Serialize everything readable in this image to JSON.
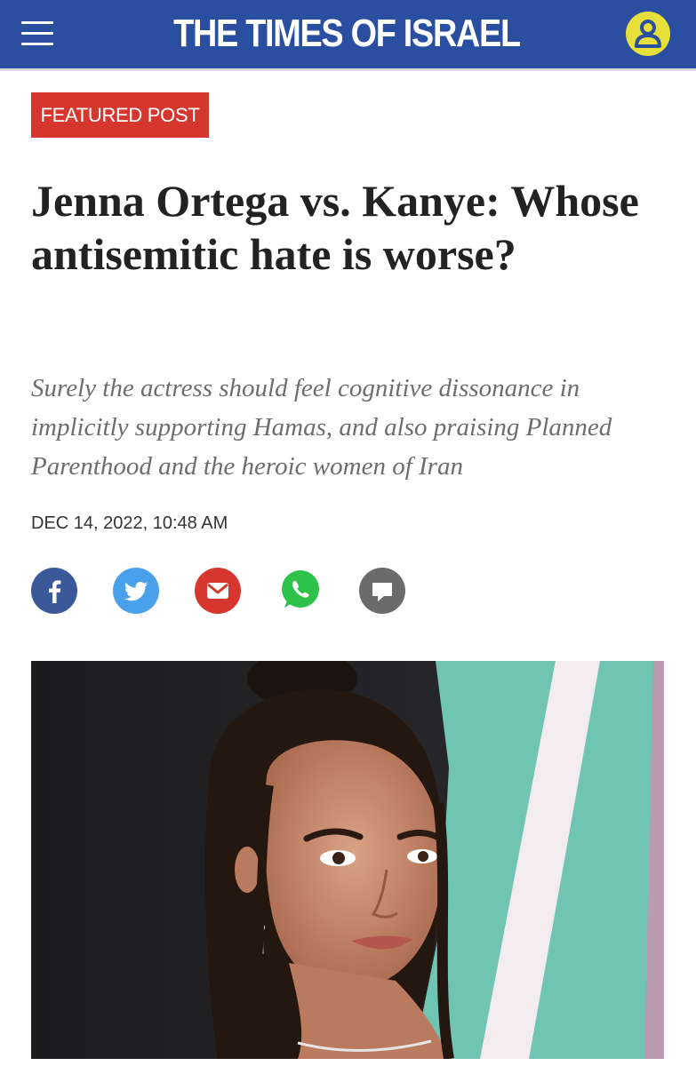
{
  "header": {
    "site_title": "THE TIMES OF ISRAEL",
    "menu_icon": "hamburger-menu-icon",
    "account_icon": "user-account-icon",
    "bar_color": "#2a4fa0",
    "account_color": "#e8e03a"
  },
  "article": {
    "badge": "FEATURED POST",
    "badge_color": "#d5372f",
    "headline": "Jenna Ortega vs. Kanye: Whose antisemitic hate is worse?",
    "subheadline": "Surely the actress should feel cognitive dissonance in implicitly supporting Hamas, and also praising Planned Parenthood and the heroic women of Iran",
    "date": "DEC 14, 2022, 10:48 AM"
  },
  "share_buttons": [
    {
      "icon": "facebook-icon",
      "color": "#3b5998"
    },
    {
      "icon": "twitter-icon",
      "color": "#4aa1eb"
    },
    {
      "icon": "email-icon",
      "color": "#d5372f"
    },
    {
      "icon": "whatsapp-icon",
      "color": "#2fc24a"
    },
    {
      "icon": "comment-icon",
      "color": "#6b6b6b"
    }
  ],
  "photo": {
    "subject": "portrait-photo"
  }
}
